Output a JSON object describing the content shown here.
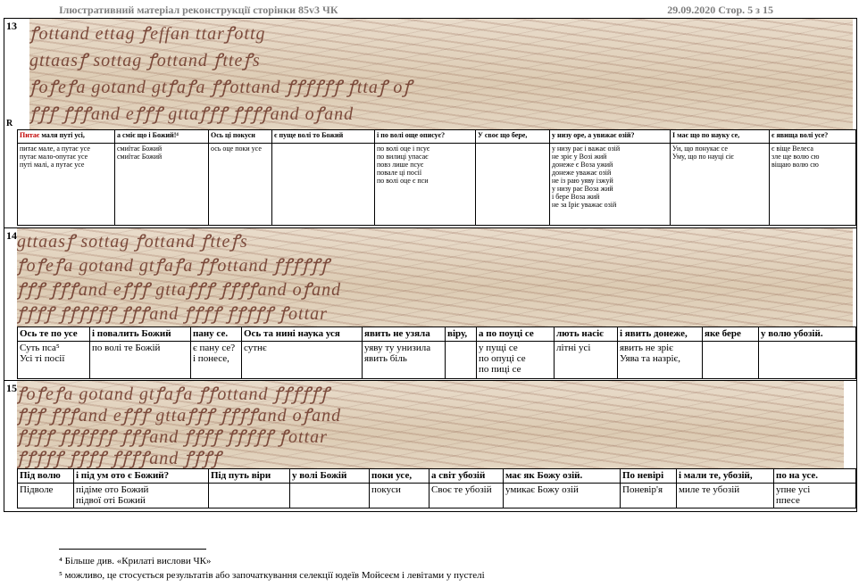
{
  "header": {
    "left": "Ілюстративний матеріал  реконструкції сторінки 85v3 ЧК",
    "right": "29.09.2020  Стор. 5 з 15"
  },
  "section13": {
    "number": "13",
    "marker": "R",
    "image_lines": [
      "ꝭottand ettag ꝭeffan ttarꝭottg",
      "gttaasꝭ sottag ꝭottand ꝭtteꝭs",
      "ꝭoꝭeꝭa gotand gtꝭaꝭa ꝭꝭottand ꝭꝭꝭꝭꝭꝭ ꝭttaꝭ oꝭ",
      "ꝭꝭꝭ ꝭꝭꝭand eꝭꝭꝭ gttaꝭꝭꝭ ꝭꝭꝭꝭand oꝭand"
    ],
    "headers": [
      "Питає маля путі усі,",
      "а сміє що і Божий!⁴",
      "Ось ці покуси",
      "є пуще волі то Божий",
      "і по волі още описує?",
      "У своє що бере,",
      "у низу оре, а увижає озій?",
      "І має що по науку се,",
      "є явища волі усе?"
    ],
    "cells": [
      [
        "питає мале, а путає усе",
        "путає мало-опутає усе",
        "путі малі, а путає усе"
      ],
      [
        "смиїтає Божий",
        "смиїтає Божий"
      ],
      [
        "ось оце поки усе"
      ],
      [],
      [
        "по волі оце і псує",
        "по вилиці упасає",
        "повз лише псує",
        "повале ці посії",
        "по волі оце є пси"
      ],
      [],
      [
        "у низу рає і важає озій",
        "не зріє у Возі жий",
        "донеже є Воза ужий",
        "донеже уважає озій",
        "не із раю уяву ізжуй",
        "у низу рає Воза жий",
        "і бере Воза жий",
        "не за Іріє уважає озій"
      ],
      [
        "Уи, що понукає се",
        "Уму, що по науці сіє"
      ],
      [
        "є віще Велеса",
        "зле ще волю сю",
        "віщаю волю сю"
      ]
    ]
  },
  "section14": {
    "number": "14",
    "image_lines": [
      "gttaasꝭ sottag ꝭottand ꝭtteꝭs",
      "ꝭoꝭeꝭa gotand gtꝭaꝭa ꝭꝭottand ꝭꝭꝭꝭꝭꝭ",
      "ꝭꝭꝭ ꝭꝭꝭand eꝭꝭꝭ gttaꝭꝭꝭ ꝭꝭꝭꝭand oꝭand",
      "ꝭꝭꝭꝭ ꝭꝭꝭꝭꝭꝭ ꝭꝭꝭand ꝭꝭꝭꝭ ꝭꝭꝭꝭꝭ ꝭottar"
    ],
    "headers": [
      "Ось те по усе",
      "і повалить Божий",
      "пану се.",
      "Ось та нині наука уся",
      "явить не узяла",
      "віру,",
      "а по поуці се",
      "лють насіє",
      "і явить донеже,",
      "яке бере",
      "у волю убозій."
    ],
    "cells": [
      [
        "Суть пса⁵",
        "Усі ті посії"
      ],
      [
        "по волі те Божій"
      ],
      [
        "є пану се?",
        "і понесе,"
      ],
      [
        "сутнє"
      ],
      [
        "уяву ту унизила",
        "явить біль"
      ],
      [],
      [
        "у пущі се",
        "по опуці се",
        "по пиці се"
      ],
      [
        "літні усі"
      ],
      [
        "явить не зріє",
        "Уява та назріє,"
      ],
      [],
      []
    ]
  },
  "section15": {
    "number": "15",
    "image_lines": [
      "ꝭoꝭeꝭa gotand gtꝭaꝭa ꝭꝭottand ꝭꝭꝭꝭꝭꝭ",
      "ꝭꝭꝭ ꝭꝭꝭand eꝭꝭꝭ gttaꝭꝭꝭ ꝭꝭꝭꝭand oꝭand",
      "ꝭꝭꝭꝭ ꝭꝭꝭꝭꝭꝭ ꝭꝭꝭand ꝭꝭꝭꝭ ꝭꝭꝭꝭꝭ ꝭottar",
      "ꝭꝭꝭꝭꝭ ꝭꝭꝭꝭ ꝭꝭꝭꝭand ꝭꝭꝭꝭ"
    ],
    "headers": [
      "Під волю",
      "і під ум ото є Божий?",
      "Під путь віри",
      "у волі Божій",
      "поки усе,",
      "а світ убозій",
      "має як Божу озій.",
      "По невірі",
      "і мали те, убозій,",
      "по на усе."
    ],
    "cells": [
      [
        "Підволе"
      ],
      [
        "підіме ото Божий",
        "підвої оті Божий"
      ],
      [],
      [],
      [
        "покуси"
      ],
      [
        "Своє те убозій"
      ],
      [
        "умикає Божу озій"
      ],
      [
        "Поневір'я"
      ],
      [
        "миле те убозій"
      ],
      [
        "упне усі",
        "ппесе"
      ]
    ]
  },
  "footnotes": [
    "⁴ Більше див. «Крилаті вислови ЧК»",
    "⁵ можливо, це стосується результатів або започаткування селекції юдеїв Мойсеєм і левітами  у пустелі"
  ]
}
